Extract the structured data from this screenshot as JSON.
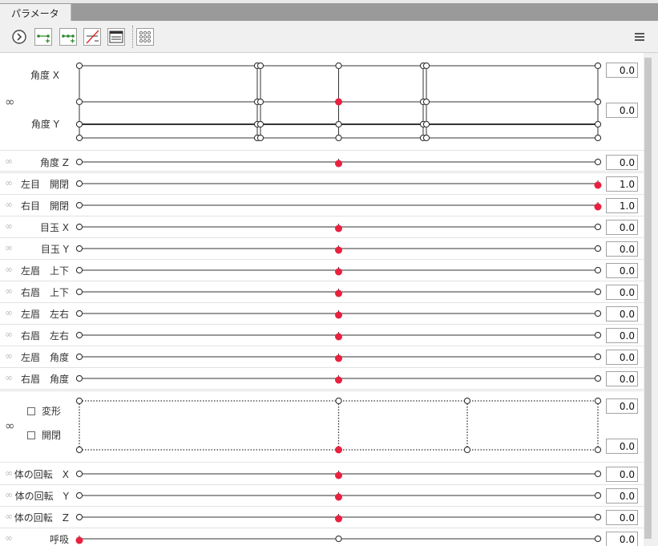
{
  "tab": {
    "label": "パラメータ"
  },
  "toolbar": {
    "buttons": [
      "play-icon",
      "add-key-2-icon",
      "add-key-3-icon",
      "delete-key-icon",
      "panel-view-icon",
      "grid-icon"
    ],
    "menu_icon": "hamburger-menu-icon"
  },
  "colors": {
    "active_key": "#e8213f",
    "track": "#333333"
  },
  "xy_block": {
    "label_x": "角度 X",
    "label_y": "角度 Y",
    "value_x": "0.0",
    "value_y": "0.0"
  },
  "params": [
    {
      "label": "角度 Z",
      "value": "0.0",
      "active_pos": 0.5
    },
    {
      "label": "左目　開閉",
      "value": "1.0",
      "active_pos": 1.0
    },
    {
      "label": "右目　開閉",
      "value": "1.0",
      "active_pos": 1.0
    },
    {
      "label": "目玉 X",
      "value": "0.0",
      "active_pos": 0.5
    },
    {
      "label": "目玉 Y",
      "value": "0.0",
      "active_pos": 0.5
    },
    {
      "label": "左眉　上下",
      "value": "0.0",
      "active_pos": 0.5
    },
    {
      "label": "右眉　上下",
      "value": "0.0",
      "active_pos": 0.5
    },
    {
      "label": "左眉　左右",
      "value": "0.0",
      "active_pos": 0.5
    },
    {
      "label": "右眉　左右",
      "value": "0.0",
      "active_pos": 0.5
    },
    {
      "label": "左眉　角度",
      "value": "0.0",
      "active_pos": 0.5
    },
    {
      "label": "右眉　角度",
      "value": "0.0",
      "active_pos": 0.5
    }
  ],
  "mouth_block": {
    "label_1": "変形",
    "label_2": "開閉",
    "value_1": "0.0",
    "value_2": "0.0"
  },
  "params2": [
    {
      "label": "体の回転　X",
      "value": "0.0",
      "active_pos": 0.5
    },
    {
      "label": "体の回転　Y",
      "value": "0.0",
      "active_pos": 0.5
    },
    {
      "label": "体の回転　Z",
      "value": "0.0",
      "active_pos": 0.5
    },
    {
      "label": "呼吸",
      "value": "0.0",
      "active_pos": 0.0
    }
  ]
}
